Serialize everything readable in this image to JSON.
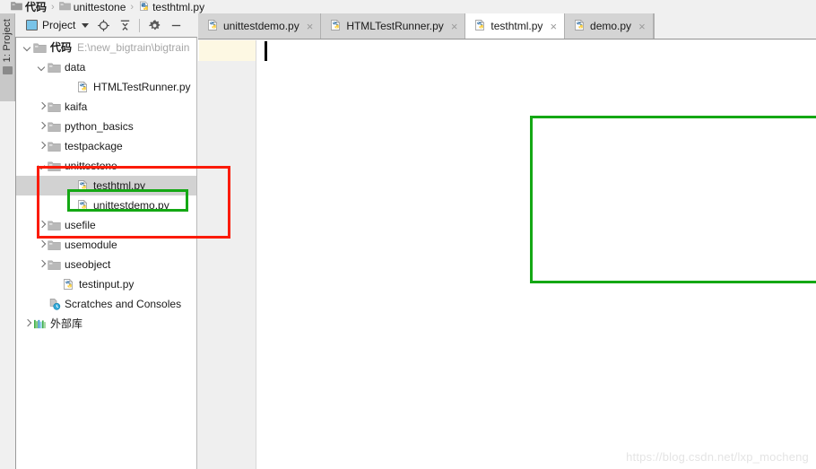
{
  "breadcrumb": {
    "items": [
      {
        "label": "代码",
        "icon": "folder-icon",
        "bold": true
      },
      {
        "label": "unittestone",
        "icon": "folder-icon",
        "bold": false
      },
      {
        "label": "testhtml.py",
        "icon": "python-file-icon",
        "bold": false
      }
    ],
    "separator": "›"
  },
  "tool_window_tab": {
    "label": "1: Project",
    "icon": "folder-icon"
  },
  "project_toolbar": {
    "title": "Project",
    "dropdown_caret": "▼",
    "buttons": [
      {
        "name": "locate-icon",
        "tooltip": "Select Opened File"
      },
      {
        "name": "collapse-all-icon",
        "tooltip": "Collapse All"
      },
      {
        "name": "gear-icon",
        "tooltip": "Settings"
      },
      {
        "name": "minimize-icon",
        "tooltip": "Hide"
      }
    ]
  },
  "tree": {
    "root_path": "E:\\new_bigtrain\\bigtrain",
    "nodes": [
      {
        "label": "代码",
        "type": "folder",
        "depth": 0,
        "state": "open",
        "bold": true,
        "path": "E:\\new_bigtrain\\bigtrain",
        "selected": false
      },
      {
        "label": "data",
        "type": "folder",
        "depth": 1,
        "state": "open",
        "bold": false,
        "path": "",
        "selected": false
      },
      {
        "label": "HTMLTestRunner.py",
        "type": "python",
        "depth": 3,
        "state": "none",
        "bold": false,
        "path": "",
        "selected": false
      },
      {
        "label": "kaifa",
        "type": "folder",
        "depth": 1,
        "state": "closed",
        "bold": false,
        "path": "",
        "selected": false
      },
      {
        "label": "python_basics",
        "type": "folder",
        "depth": 1,
        "state": "closed",
        "bold": false,
        "path": "",
        "selected": false
      },
      {
        "label": "testpackage",
        "type": "folder",
        "depth": 1,
        "state": "closed",
        "bold": false,
        "path": "",
        "selected": false
      },
      {
        "label": "unittestone",
        "type": "folder",
        "depth": 1,
        "state": "open",
        "bold": false,
        "path": "",
        "selected": false
      },
      {
        "label": "testhtml.py",
        "type": "python",
        "depth": 3,
        "state": "none",
        "bold": false,
        "path": "",
        "selected": true
      },
      {
        "label": "unittestdemo.py",
        "type": "python",
        "depth": 3,
        "state": "none",
        "bold": false,
        "path": "",
        "selected": false
      },
      {
        "label": "usefile",
        "type": "folder",
        "depth": 1,
        "state": "closed",
        "bold": false,
        "path": "",
        "selected": false
      },
      {
        "label": "usemodule",
        "type": "folder",
        "depth": 1,
        "state": "closed",
        "bold": false,
        "path": "",
        "selected": false
      },
      {
        "label": "useobject",
        "type": "folder",
        "depth": 1,
        "state": "closed",
        "bold": false,
        "path": "",
        "selected": false
      },
      {
        "label": "testinput.py",
        "type": "python",
        "depth": 2,
        "state": "none",
        "bold": false,
        "path": "",
        "selected": false
      },
      {
        "label": "Scratches and Consoles",
        "type": "scratches",
        "depth": 1,
        "state": "none",
        "bold": false,
        "path": "",
        "selected": false
      },
      {
        "label": "外部库",
        "type": "library",
        "depth": 0,
        "state": "closed",
        "bold": false,
        "path": "",
        "selected": false
      }
    ]
  },
  "editor_tabs": [
    {
      "label": "unittestdemo.py",
      "icon": "python-file-icon",
      "active": false,
      "close": "×"
    },
    {
      "label": "HTMLTestRunner.py",
      "icon": "python-file-icon",
      "active": false,
      "close": "×"
    },
    {
      "label": "testhtml.py",
      "icon": "python-file-icon",
      "active": true,
      "close": "×"
    },
    {
      "label": "demo.py",
      "icon": "python-file-icon",
      "active": false,
      "close": "×"
    }
  ],
  "editor": {
    "content": "",
    "gutter_highlight_color": "#fdf8e3",
    "caret_visible": true
  },
  "annotations": {
    "red_box_color": "#fb1b07",
    "green_box_color": "#14a814",
    "red_box_label": "",
    "green_box_tree_label": "",
    "green_box_editor_label": ""
  },
  "watermark": {
    "text": "https://blog.csdn.net/lxp_mocheng"
  }
}
